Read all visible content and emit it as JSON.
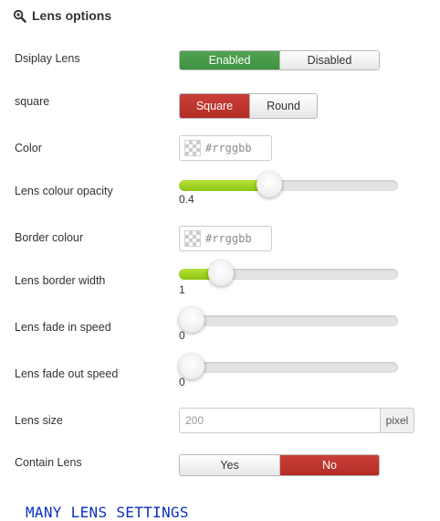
{
  "header": {
    "title": "Lens options",
    "icon": "zoom-in-icon"
  },
  "display_lens": {
    "label": "Dsiplay Lens",
    "options": [
      "Enabled",
      "Disabled"
    ],
    "selected": "Enabled"
  },
  "shape": {
    "label": "square",
    "options": [
      "Square",
      "Round"
    ],
    "selected": "Square"
  },
  "color": {
    "label": "Color",
    "placeholder": "#rrggbb"
  },
  "opacity": {
    "label": "Lens colour opacity",
    "value": "0.4",
    "fraction": 0.4
  },
  "border_colour": {
    "label": "Border colour",
    "placeholder": "#rrggbb"
  },
  "border_width": {
    "label": "Lens border width",
    "value": "1",
    "fraction": 0.15
  },
  "fade_in": {
    "label": "Lens fade in speed",
    "value": "0",
    "fraction": 0
  },
  "fade_out": {
    "label": "Lens fade out speed",
    "value": "0",
    "fraction": 0
  },
  "lens_size": {
    "label": "Lens size",
    "placeholder": "200",
    "unit": "pixel"
  },
  "contain_lens": {
    "label": "Contain Lens",
    "options": [
      "Yes",
      "No"
    ],
    "selected": "No"
  },
  "footer": {
    "text": "MANY LENS SETTINGS"
  },
  "colors": {
    "green": "#449d44",
    "red": "#bd362f",
    "slider_fill": "#9fd420",
    "footer_text": "#0b2fc4"
  }
}
